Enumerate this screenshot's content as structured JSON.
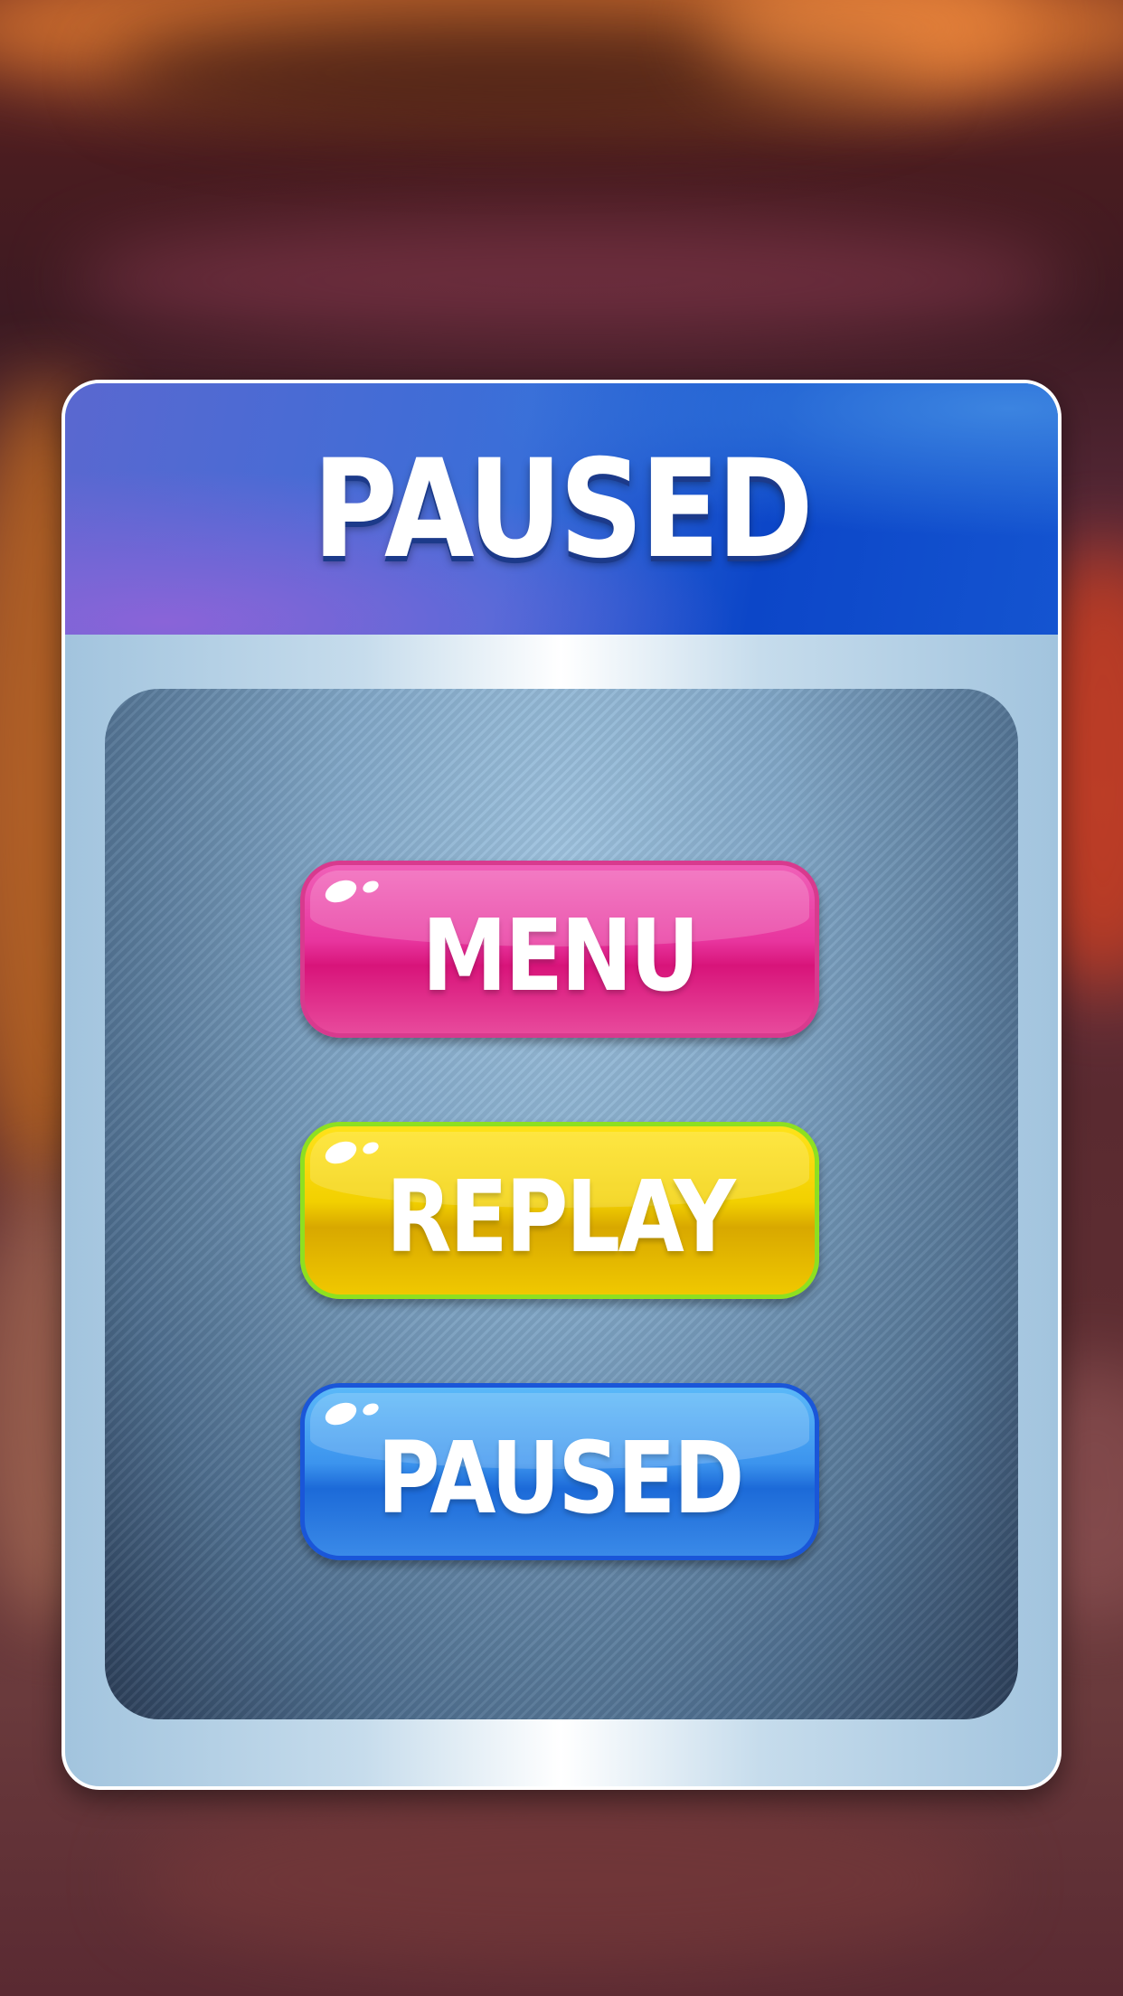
{
  "dialog": {
    "title": "PAUSED"
  },
  "buttons": {
    "menu": "MENU",
    "replay": "REPLAY",
    "paused": "PAUSED"
  },
  "colors": {
    "header_blue": "#1454d0",
    "menu_pink": "#e8359e",
    "replay_yellow": "#f2d000",
    "replay_border_green": "#8ee020",
    "paused_blue": "#3c94ee"
  }
}
